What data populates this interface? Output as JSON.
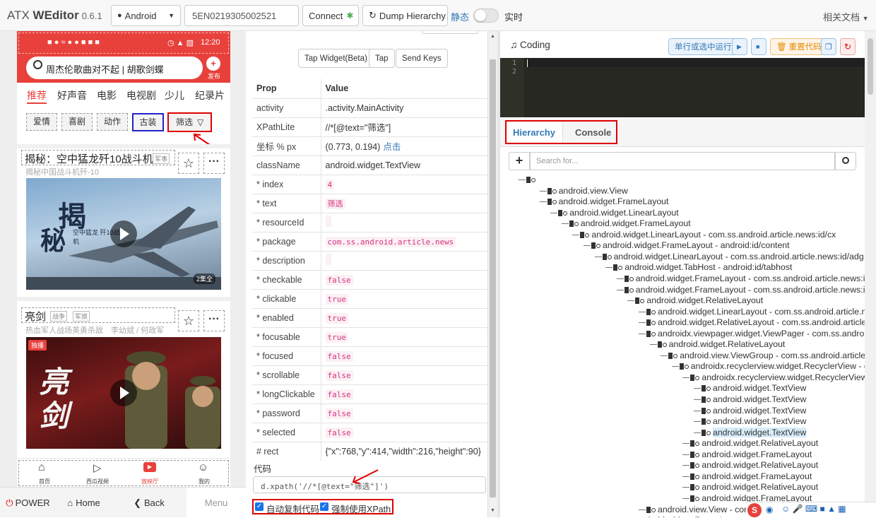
{
  "header": {
    "brand_prefix": "ATX ",
    "brand_name": "WEditor",
    "version": "0.6.1",
    "platform": "Android",
    "device_serial": "5EN0219305002521",
    "connect_label": "Connect",
    "dump_label": "Dump Hierarchy",
    "static_label": "静态",
    "realtime_label": "实时",
    "docs_label": "相关文档"
  },
  "phone": {
    "status_time": "12:20",
    "search_text": "周杰伦歌曲对不起 | 胡歌剑蝶",
    "publish_label": "发布",
    "tabs": [
      "推荐",
      "好声音",
      "电影",
      "电视剧",
      "少儿",
      "纪录片"
    ],
    "filters": [
      "爱情",
      "喜剧",
      "动作",
      "古装",
      "筛选"
    ],
    "card1": {
      "title": "揭秘：空中猛龙歼10战斗机",
      "tag": "军事",
      "subtitle": "揭秘中国战斗机歼-10",
      "poster_big": "揭",
      "poster_big2": "秘",
      "poster_small": "空中猛龙 歼10战斗机",
      "badge": "2集全"
    },
    "card2": {
      "title": "亮剑",
      "tags": [
        "战争",
        "军旅"
      ],
      "subtitle": "热血军人战场英勇杀敌　李幼斌 / 何政军",
      "exclusive": "独播",
      "poster_text": "亮剑"
    },
    "nav": [
      "首页",
      "西瓜视频",
      "放映厅",
      "我的"
    ]
  },
  "bottom": {
    "power": "POWER",
    "home": "Home",
    "back": "Back",
    "menu": "Menu"
  },
  "inspector": {
    "buttons": [
      "Tap Widget(Beta)",
      "Tap",
      "Send Keys"
    ],
    "col_prop": "Prop",
    "col_value": "Value",
    "rows": [
      {
        "prop": "activity",
        "value": ".activity.MainActivity",
        "type": "plain"
      },
      {
        "prop": "XPathLite",
        "value": "//*[@text=\"筛选\"]",
        "type": "plain"
      },
      {
        "prop": "坐标 % px",
        "value": "(0.773, 0.194)",
        "link": "点击",
        "type": "coord"
      },
      {
        "prop": "className",
        "value": "android.widget.TextView",
        "type": "plain"
      },
      {
        "prop": "* index",
        "value": "4",
        "type": "code"
      },
      {
        "prop": "* text",
        "value": "筛选",
        "type": "code"
      },
      {
        "prop": "* resourceId",
        "value": "",
        "type": "code"
      },
      {
        "prop": "* package",
        "value": "com.ss.android.article.news",
        "type": "code"
      },
      {
        "prop": "* description",
        "value": "",
        "type": "code"
      },
      {
        "prop": "* checkable",
        "value": "false",
        "type": "code"
      },
      {
        "prop": "* clickable",
        "value": "true",
        "type": "code"
      },
      {
        "prop": "* enabled",
        "value": "true",
        "type": "code"
      },
      {
        "prop": "* focusable",
        "value": "true",
        "type": "code"
      },
      {
        "prop": "* focused",
        "value": "false",
        "type": "code"
      },
      {
        "prop": "* scrollable",
        "value": "false",
        "type": "code"
      },
      {
        "prop": "* longClickable",
        "value": "false",
        "type": "code"
      },
      {
        "prop": "* password",
        "value": "false",
        "type": "code"
      },
      {
        "prop": "* selected",
        "value": "false",
        "type": "code"
      },
      {
        "prop": "# rect",
        "value": "{\"x\":768,\"y\":414,\"width\":216,\"height\":90}",
        "type": "plain"
      }
    ],
    "code_label": "代码",
    "code_value": "d.xpath('//*[@text=\"筛选\"]')",
    "auto_copy_label": "自动复制代码",
    "force_xpath_label": "强制使用XPath"
  },
  "coding": {
    "title": "Coding",
    "run_label": "单行或选中运行",
    "reset_label": "重置代码",
    "line_numbers": [
      "1",
      "2"
    ]
  },
  "tabs": {
    "hierarchy": "Hierarchy",
    "console": "Console"
  },
  "search_placeholder": "Search for...",
  "tree": [
    {
      "d": 0,
      "t": ""
    },
    {
      "d": 1,
      "t": "android.view.View"
    },
    {
      "d": 1,
      "t": "android.widget.FrameLayout"
    },
    {
      "d": 2,
      "t": "android.widget.LinearLayout"
    },
    {
      "d": 3,
      "t": "android.widget.FrameLayout"
    },
    {
      "d": 4,
      "t": "android.widget.LinearLayout - com.ss.android.article.news:id/cx"
    },
    {
      "d": 5,
      "t": "android.widget.FrameLayout - android:id/content"
    },
    {
      "d": 6,
      "t": "android.widget.LinearLayout - com.ss.android.article.news:id/adg"
    },
    {
      "d": 7,
      "t": "android.widget.TabHost - android:id/tabhost"
    },
    {
      "d": 8,
      "t": "android.widget.FrameLayout - com.ss.android.article.news:id/cp9"
    },
    {
      "d": 8,
      "t": "android.widget.FrameLayout - com.ss.android.article.news:id/czk"
    },
    {
      "d": 9,
      "t": "android.widget.RelativeLayout"
    },
    {
      "d": 10,
      "t": "android.widget.LinearLayout - com.ss.android.article.news:id"
    },
    {
      "d": 10,
      "t": "android.widget.RelativeLayout - com.ss.android.article.news"
    },
    {
      "d": 10,
      "t": "androidx.viewpager.widget.ViewPager - com.ss.android.articl"
    },
    {
      "d": 11,
      "t": "android.widget.RelativeLayout"
    },
    {
      "d": 12,
      "t": "android.view.ViewGroup - com.ss.android.article.news"
    },
    {
      "d": 13,
      "t": "androidx.recyclerview.widget.RecyclerView - com.ss"
    },
    {
      "d": 14,
      "t": "androidx.recyclerview.widget.RecyclerView"
    },
    {
      "d": 15,
      "t": "android.widget.TextView"
    },
    {
      "d": 15,
      "t": "android.widget.TextView"
    },
    {
      "d": 15,
      "t": "android.widget.TextView"
    },
    {
      "d": 15,
      "t": "android.widget.TextView"
    },
    {
      "d": 15,
      "t": "android.widget.TextView",
      "selected": true
    },
    {
      "d": 14,
      "t": "android.widget.RelativeLayout"
    },
    {
      "d": 14,
      "t": "android.widget.FrameLayout"
    },
    {
      "d": 14,
      "t": "android.widget.RelativeLayout"
    },
    {
      "d": 14,
      "t": "android.widget.FrameLayout"
    },
    {
      "d": 14,
      "t": "android.widget.RelativeLayout"
    },
    {
      "d": 14,
      "t": "android.widget.FrameLayout"
    },
    {
      "d": 10,
      "t": "android.view.View - com.ss"
    },
    {
      "d": 8,
      "t": "android.widget.FrameLayout - com"
    }
  ],
  "colors": {
    "accent": "#337ab7",
    "highlight": "#e00000",
    "phone_red": "#e8413c"
  }
}
